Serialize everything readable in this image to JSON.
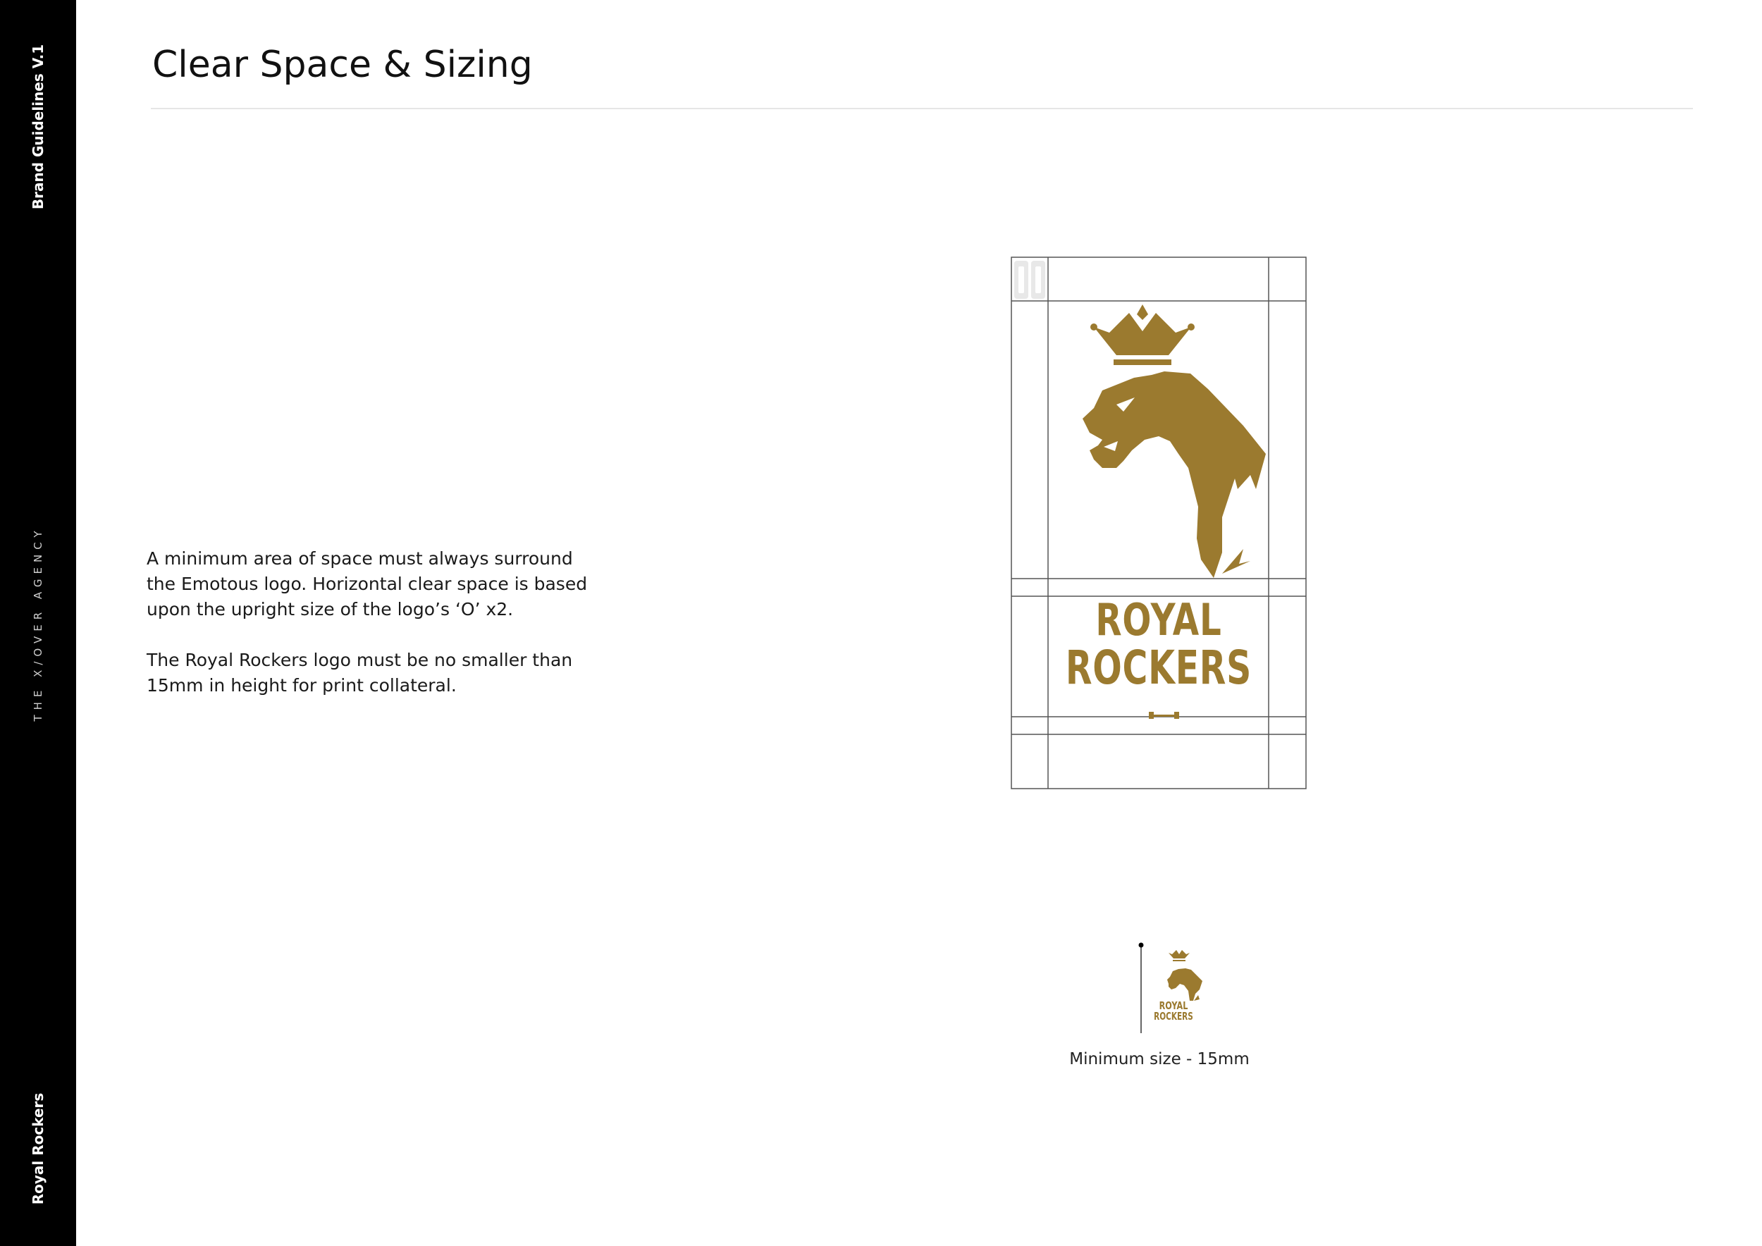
{
  "sidebar": {
    "doc_label": "Brand Guidelines V.1",
    "agency": "THE X/OVER AGENCY",
    "client": "Royal Rockers"
  },
  "page": {
    "title": "Clear Space & Sizing"
  },
  "body_text": {
    "paragraph_1": "A minimum area of space must always surround the Emotous logo. Horizontal clear space is based upon the upright size of the logo’s ‘O’ x2.",
    "paragraph_2": "The Royal Rockers logo must be no smaller than 15mm in height for print collateral."
  },
  "logo": {
    "wordmark_line_1": "ROYAL",
    "wordmark_line_2": "ROCKERS",
    "color": "#9b7a2f"
  },
  "minimum_size": {
    "caption": "Minimum size - 15mm"
  },
  "colors": {
    "sidebar": "#000000",
    "brand_gold": "#9b7a2f",
    "grid_lines": "#555555"
  }
}
